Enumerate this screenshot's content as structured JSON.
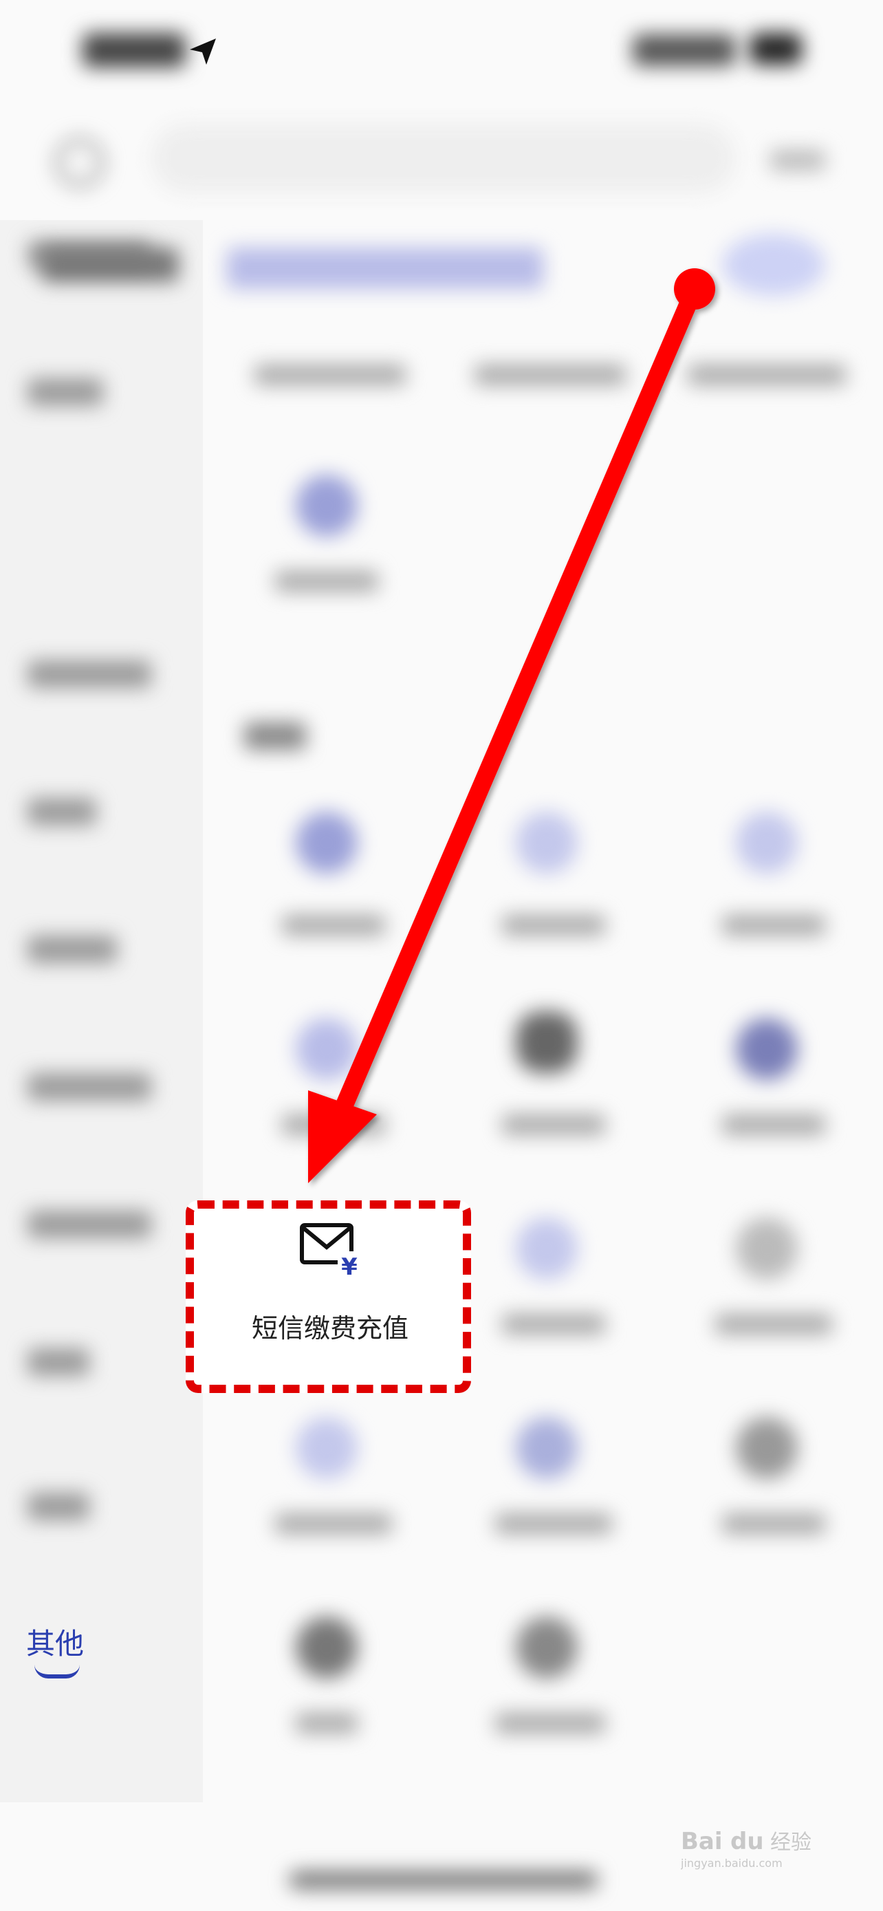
{
  "category": {
    "active_label": "其他"
  },
  "highlighted_item": {
    "label": "短信缴费充值",
    "icon": "envelope-yen-icon"
  },
  "colors": {
    "accent": "#2b3fb0",
    "annotation_red": "#e00000"
  },
  "watermark": {
    "brand": "Bai",
    "brand_paw": "du",
    "brand_cn": "经验",
    "url": "jingyan.baidu.com"
  }
}
